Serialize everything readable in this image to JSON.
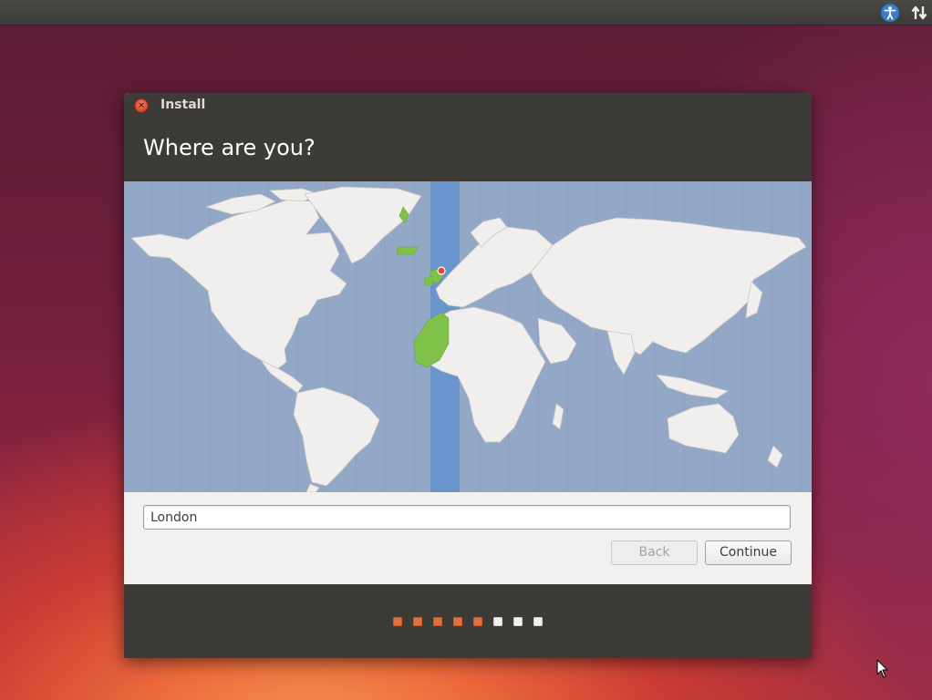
{
  "top_panel": {
    "icons": [
      "accessibility-icon",
      "network-icon"
    ]
  },
  "window": {
    "title": "Install",
    "heading": "Where are you?",
    "location": {
      "value": "London",
      "placeholder": ""
    },
    "buttons": {
      "back": "Back",
      "continue": "Continue"
    },
    "progress": {
      "total_steps": 8,
      "completed_steps": 5
    }
  },
  "colors": {
    "accent": "#e0703d",
    "panel_dark": "#3c3b37",
    "map_ocean": "#93a7c7",
    "map_land": "#f1efed",
    "selected_timezone": "#80c14a",
    "timezone_band": "#6a94cc"
  }
}
